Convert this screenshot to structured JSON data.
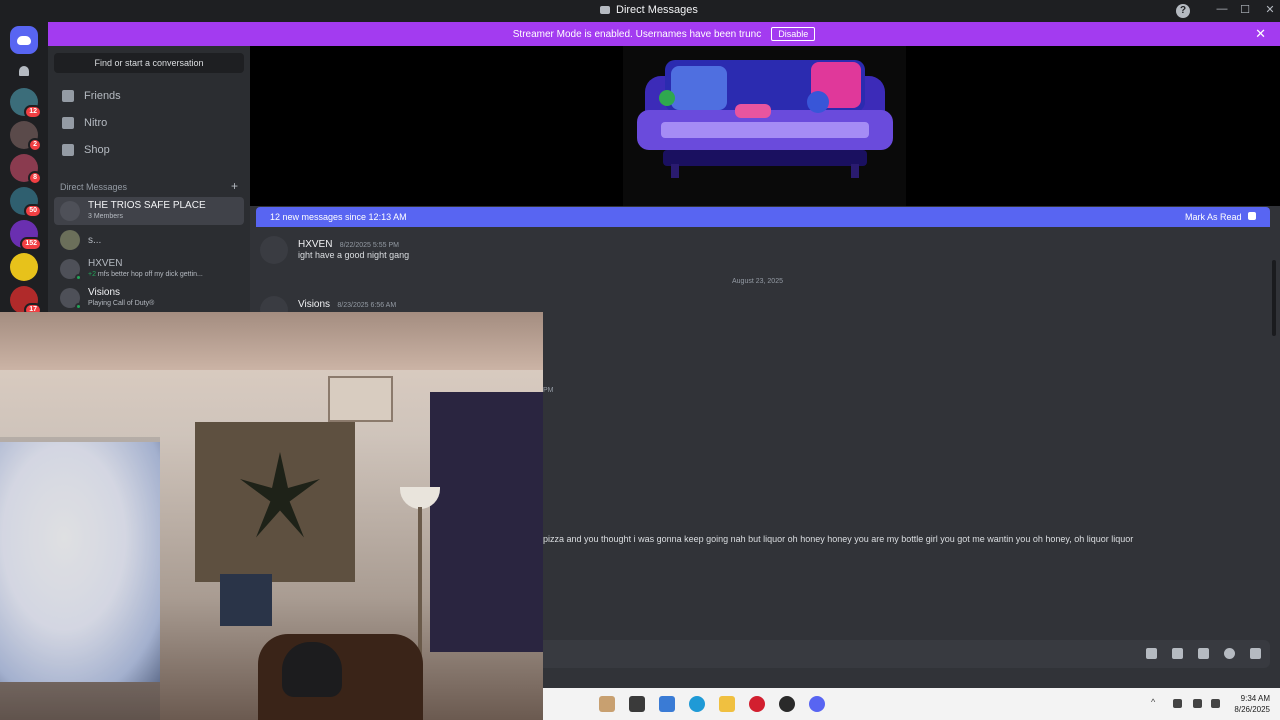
{
  "window": {
    "title": "Direct Messages",
    "help": "?",
    "minimize": "—",
    "maximize": "☐",
    "close": "✕"
  },
  "banner": {
    "text": "Streamer Mode is enabled. Usernames have been trunc",
    "disable_label": "Disable",
    "close": "✕"
  },
  "servers": [
    {
      "badge": "12",
      "color": "#3b6d7a"
    },
    {
      "badge": "2",
      "color": "#5a4a4a"
    },
    {
      "badge": "8",
      "color": "#8a3b4f"
    },
    {
      "badge": "50",
      "color": "#2f5f6f"
    },
    {
      "badge": "152",
      "color": "#6a2fb0"
    },
    {
      "badge": "",
      "color": "#e7c21b"
    },
    {
      "badge": "17",
      "color": "#b02a2a"
    }
  ],
  "sidebar": {
    "search_label": "Find or start a conversation",
    "nav": [
      {
        "label": "Friends"
      },
      {
        "label": "Nitro"
      },
      {
        "label": "Shop"
      }
    ],
    "dm_header": "Direct Messages",
    "dm_add": "+",
    "dms": [
      {
        "name": "THE TRIOS SAFE PLACE",
        "sub": "3 Members",
        "sub_green": ""
      },
      {
        "name": "s...",
        "sub": "",
        "sub_green": ""
      },
      {
        "name": "HXVEN",
        "sub": " mfs better hop off my dick gettin...",
        "sub_green": "+2"
      },
      {
        "name": "Visions",
        "sub": "Playing Call of Duty®",
        "sub_green": ""
      }
    ]
  },
  "chat": {
    "new_messages": "12 new messages since 12:13 AM",
    "mark_read": "Mark As Read",
    "messages": [
      {
        "author": "HXVEN",
        "time": "8/22/2025 5:55 PM",
        "body": "ight have a good night gang"
      },
      {
        "author": "Visions",
        "time": "8/23/2025 6:56 AM",
        "body": ""
      }
    ],
    "date_divider": "August 23, 2025",
    "stray_pm": "PM",
    "stray_text": "pizza and you thought i was gonna keep going nah but liquor oh honey honey you are my bottle girl you got me wantin you oh honey, oh liquor liquor"
  },
  "composer_icons": [
    "gift-icon",
    "gif-icon",
    "sticker-icon",
    "emoji-icon",
    "activity-icon"
  ],
  "taskbar": {
    "apps": [
      {
        "name": "cat-app-icon",
        "color": "#c8a070"
      },
      {
        "name": "file-manager-icon",
        "color": "#3a3a3a"
      },
      {
        "name": "notepad-icon",
        "color": "#3a7bd5"
      },
      {
        "name": "edge-icon",
        "color": "#1f9ad6"
      },
      {
        "name": "folder-icon",
        "color": "#f0c040"
      },
      {
        "name": "opera-icon",
        "color": "#d21f2f"
      },
      {
        "name": "obs-icon",
        "color": "#2a2a2a"
      },
      {
        "name": "discord-taskbar-icon",
        "color": "#5865f2"
      }
    ],
    "time": "9:34 AM",
    "date": "8/26/2025"
  }
}
